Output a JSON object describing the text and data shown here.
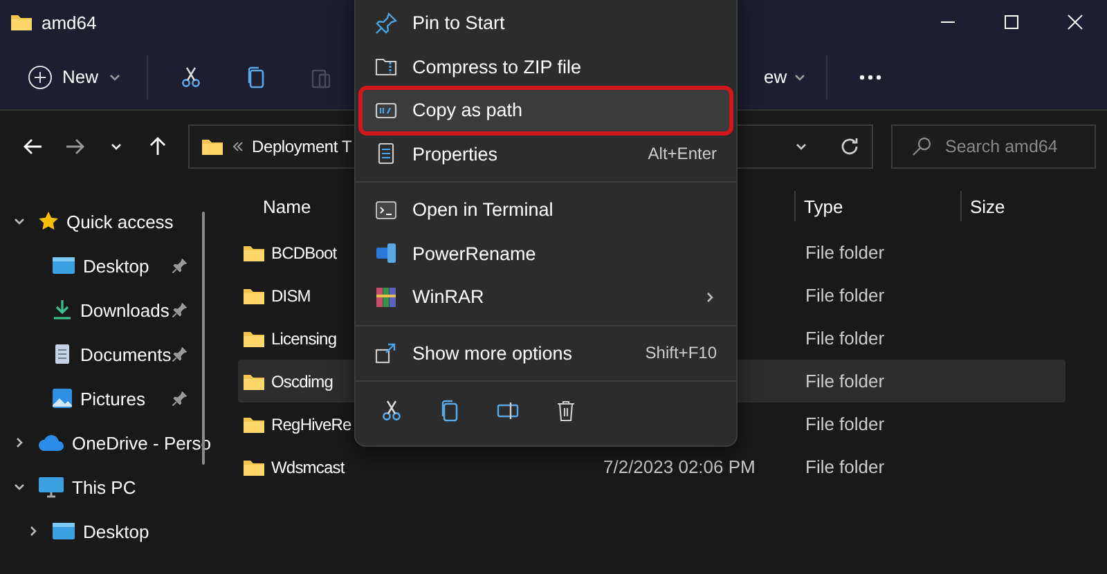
{
  "window": {
    "title": "amd64"
  },
  "toolbar": {
    "new_label": "New",
    "buttons": [
      {
        "kind": "cut",
        "disabled": false
      },
      {
        "kind": "copy",
        "disabled": false
      },
      {
        "kind": "paste",
        "disabled": true
      }
    ],
    "view_label": "ew"
  },
  "address": {
    "path": "Deployment T"
  },
  "search": {
    "placeholder": "Search amd64"
  },
  "sidebar": {
    "items": [
      {
        "label": "Quick access",
        "expanded": true,
        "children": [
          {
            "label": "Desktop",
            "pinned": true
          },
          {
            "label": "Downloads",
            "pinned": true
          },
          {
            "label": "Documents",
            "pinned": true
          },
          {
            "label": "Pictures",
            "pinned": true
          }
        ]
      },
      {
        "label": "OneDrive - Perso",
        "expanded": false
      },
      {
        "label": "This PC",
        "expanded": true,
        "children": [
          {
            "label": "Desktop",
            "expanded": false
          }
        ]
      }
    ]
  },
  "table": {
    "columns": [
      "Name",
      "Type",
      "Size"
    ],
    "rows": [
      {
        "name": "BCDBoot",
        "type": "File folder",
        "selected": false
      },
      {
        "name": "DISM",
        "type": "File folder",
        "selected": false
      },
      {
        "name": "Licensing",
        "type": "File folder",
        "selected": false
      },
      {
        "name": "Oscdimg",
        "type": "File folder",
        "selected": true
      },
      {
        "name": "RegHiveRe",
        "type": "File folder",
        "selected": false
      },
      {
        "name": "Wdsmcast",
        "date": "7/2/2023 02:06 PM",
        "type": "File folder",
        "selected": false
      }
    ]
  },
  "context_menu": {
    "items": [
      {
        "kind": "item",
        "label": "Pin to Start",
        "selected": false
      },
      {
        "kind": "item",
        "label": "Compress to ZIP file",
        "selected": false
      },
      {
        "kind": "item",
        "label": "Copy as path",
        "selected": true
      },
      {
        "kind": "item",
        "label": "Properties",
        "shortcut": "Alt+Enter",
        "selected": false
      },
      {
        "kind": "separator"
      },
      {
        "kind": "item",
        "label": "Open in Terminal",
        "selected": false
      },
      {
        "kind": "item",
        "label": "PowerRename",
        "selected": false
      },
      {
        "kind": "item",
        "label": "WinRAR",
        "submenu": true,
        "selected": false
      },
      {
        "kind": "separator"
      },
      {
        "kind": "item",
        "label": "Show more options",
        "shortcut": "Shift+F10",
        "selected": false
      },
      {
        "kind": "separator"
      },
      {
        "kind": "actions"
      }
    ]
  }
}
